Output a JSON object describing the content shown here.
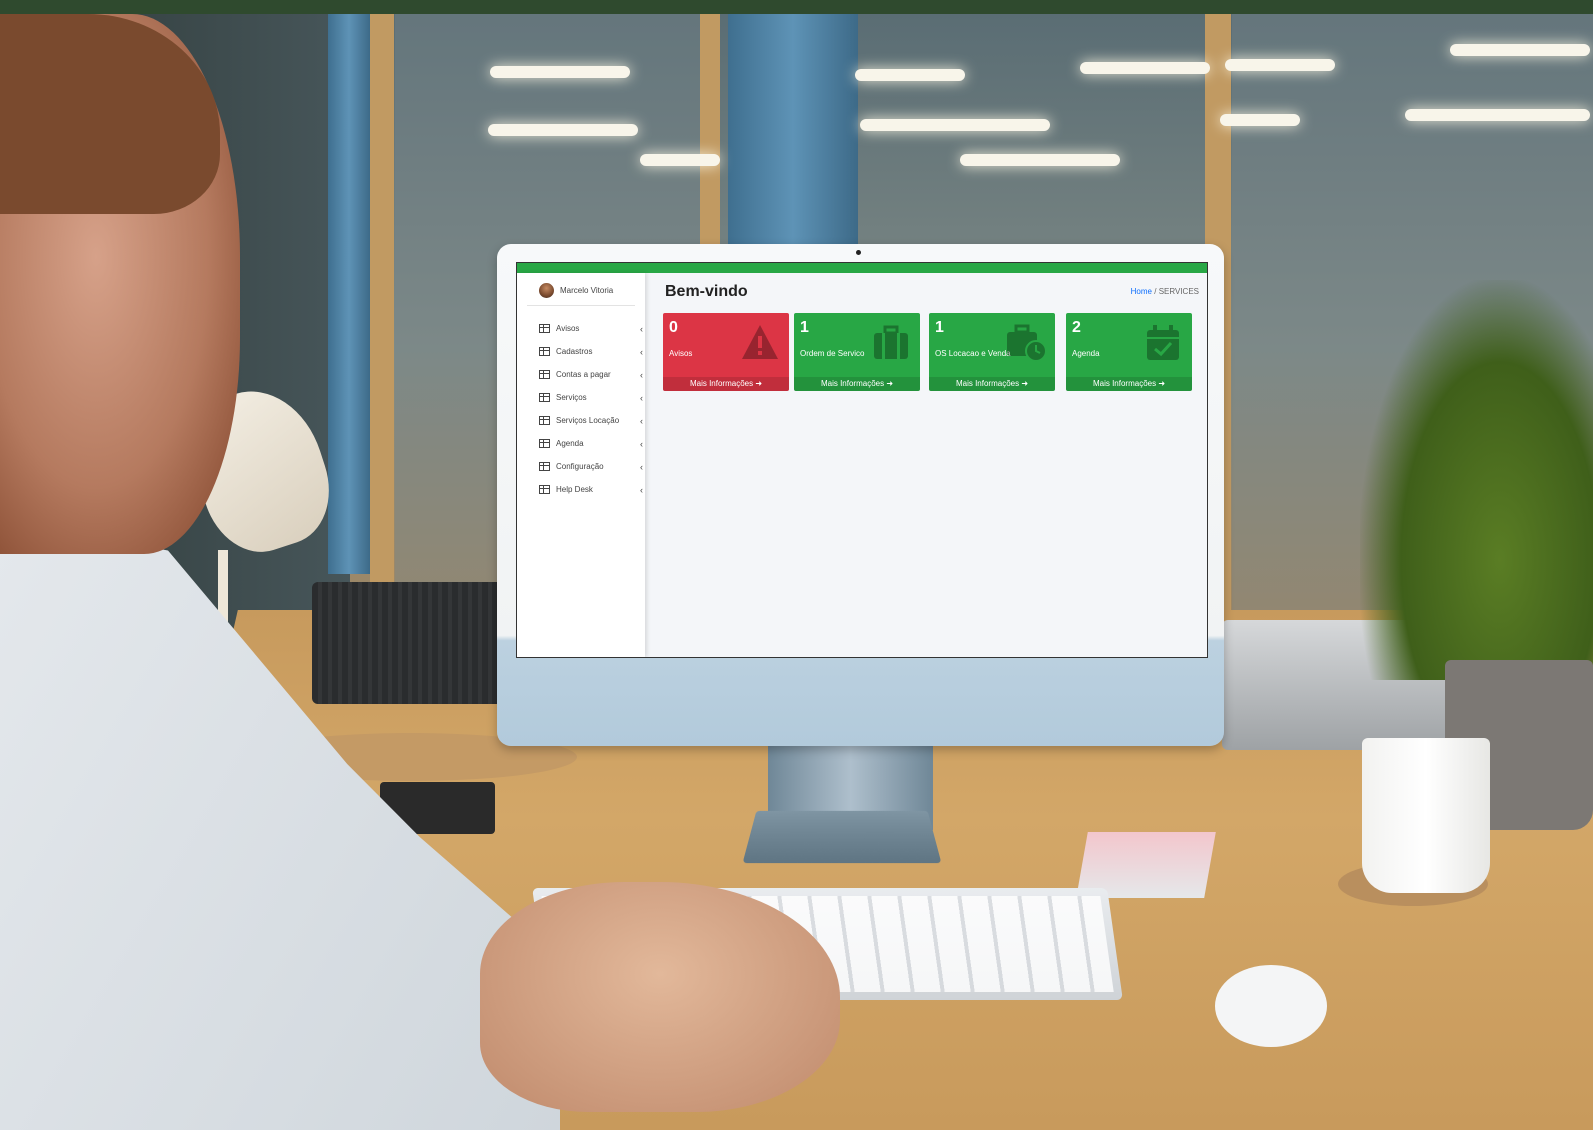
{
  "user": {
    "name": "Marcelo Vitoria"
  },
  "sidebar": {
    "items": [
      {
        "label": "Avisos"
      },
      {
        "label": "Cadastros"
      },
      {
        "label": "Contas a pagar"
      },
      {
        "label": "Serviços"
      },
      {
        "label": "Serviços Locação"
      },
      {
        "label": "Agenda"
      },
      {
        "label": "Configuração"
      },
      {
        "label": "Help Desk"
      }
    ]
  },
  "header": {
    "title": "Bem-vindo"
  },
  "breadcrumb": {
    "home": "Home",
    "separator": "/",
    "current": "SERVICES"
  },
  "boxes": [
    {
      "count": "0",
      "label": "Avisos",
      "link": "Mais Informações",
      "color": "#dc3545",
      "icon": "warning-icon"
    },
    {
      "count": "1",
      "label": "Ordem de Servico",
      "link": "Mais Informações",
      "color": "#28a745",
      "icon": "briefcase-icon"
    },
    {
      "count": "1",
      "label": "OS Locacao e Venda",
      "link": "Mais Informações",
      "color": "#28a745",
      "icon": "briefcase-clock-icon"
    },
    {
      "count": "2",
      "label": "Agenda",
      "link": "Mais Informações",
      "color": "#28a745",
      "icon": "calendar-check-icon"
    }
  ],
  "colors": {
    "top_bar": "#28a745",
    "danger": "#dc3545",
    "success": "#28a745"
  }
}
